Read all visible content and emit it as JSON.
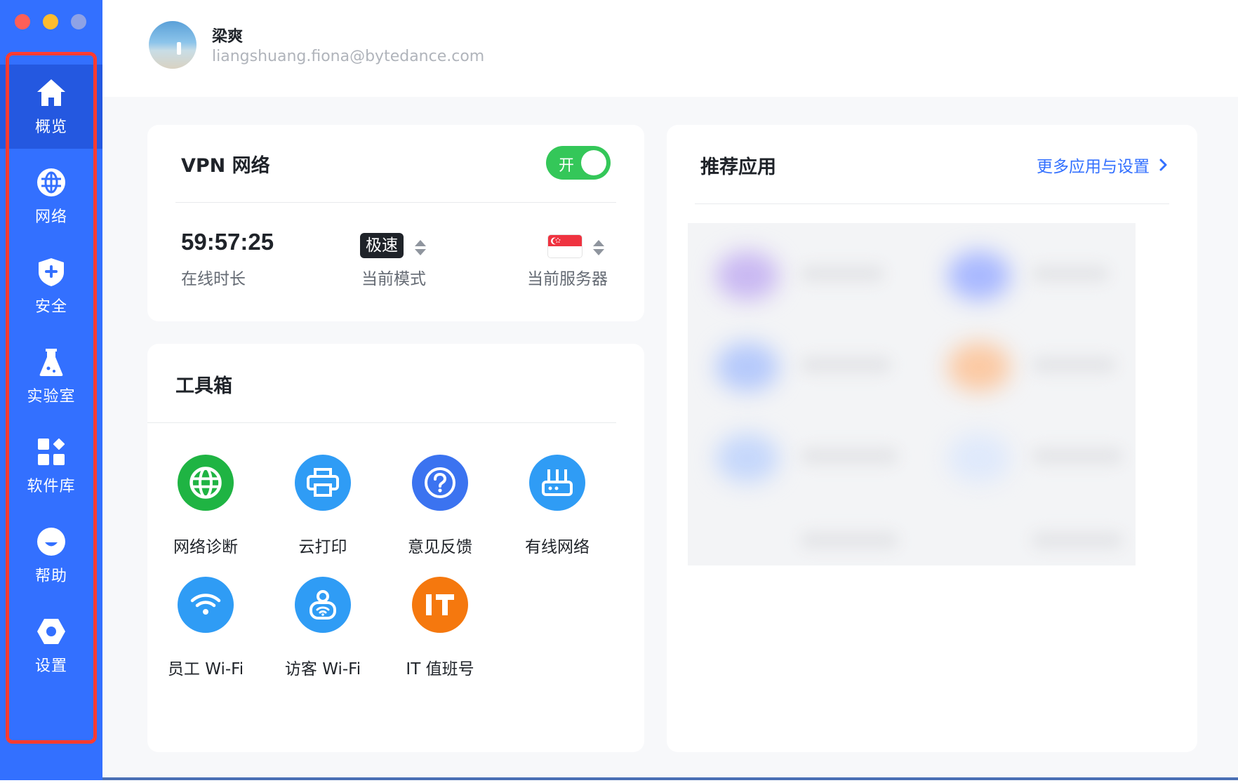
{
  "sidebar": {
    "items": [
      {
        "label": "概览",
        "icon": "home-icon",
        "active": true
      },
      {
        "label": "网络",
        "icon": "globe-icon"
      },
      {
        "label": "安全",
        "icon": "shield-icon"
      },
      {
        "label": "实验室",
        "icon": "flask-icon"
      },
      {
        "label": "软件库",
        "icon": "apps-grid-icon"
      },
      {
        "label": "帮助",
        "icon": "help-icon"
      },
      {
        "label": "设置",
        "icon": "gear-icon"
      }
    ]
  },
  "user": {
    "name": "梁爽",
    "email": "liangshuang.fiona@bytedance.com"
  },
  "vpn": {
    "title": "VPN 网络",
    "toggle_label": "开",
    "online_time": "59:57:25",
    "online_time_label": "在线时长",
    "mode_value": "极速",
    "mode_label": "当前模式",
    "server_label": "当前服务器"
  },
  "toolbox": {
    "title": "工具箱",
    "tools": [
      {
        "label": "网络诊断",
        "icon": "globe-icon",
        "color": "#1fb443"
      },
      {
        "label": "云打印",
        "icon": "printer-icon",
        "color": "#2f9cf5"
      },
      {
        "label": "意见反馈",
        "icon": "question-icon",
        "color": "#3b73f0"
      },
      {
        "label": "有线网络",
        "icon": "router-icon",
        "color": "#2f9cf5"
      },
      {
        "label": "员工 Wi-Fi",
        "icon": "wifi-icon",
        "color": "#2f9cf5"
      },
      {
        "label": "访客 Wi-Fi",
        "icon": "guest-wifi-icon",
        "color": "#2f9cf5"
      },
      {
        "label": "IT 值班号",
        "icon": "it-icon",
        "color": "#f5780e"
      }
    ]
  },
  "recommended": {
    "title": "推荐应用",
    "more_link": "更多应用与设置"
  },
  "colors": {
    "sidebar": "#3370ff",
    "sidebar_active": "#2458e0",
    "toggle_on": "#34c759",
    "link": "#3370ff"
  }
}
